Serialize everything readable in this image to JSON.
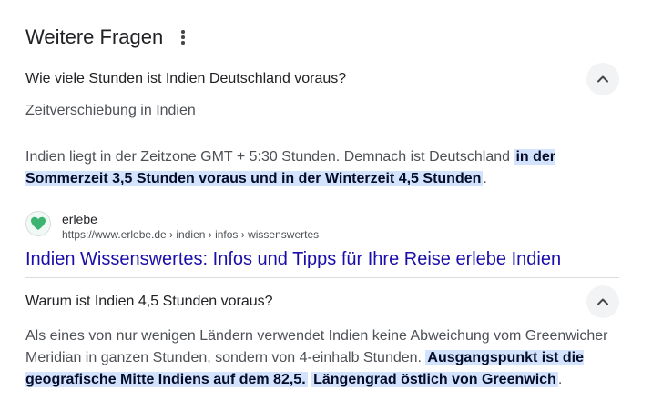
{
  "section": {
    "title": "Weitere Fragen",
    "more_icon": "more-vert-icon"
  },
  "questions": [
    {
      "question": "Wie viele Stunden ist Indien Deutschland voraus?",
      "expanded": true,
      "answer_heading": "Zeitverschiebung in Indien",
      "answer_plain": "Indien liegt in der Zeitzone GMT + 5:30 Stunden. Demnach ist Deutschland ",
      "answer_highlight": "in der Sommerzeit 3,5 Stunden voraus und in der Winterzeit 4,5 Stunden",
      "answer_end": ".",
      "source": {
        "name": "erlebe",
        "url": "https://www.erlebe.de › indien › infos › wissenswertes",
        "favicon": "heart-icon",
        "favicon_color": "#3cb371"
      },
      "result_title": "Indien Wissenswertes: Infos und Tipps für Ihre Reise erlebe Indien"
    },
    {
      "question": "Warum ist Indien 4,5 Stunden voraus?",
      "expanded": true,
      "answer_plain": "Als eines von nur wenigen Ländern verwendet Indien keine Abweichung vom Greenwicher Meridian in ganzen Stunden, sondern von 4-einhalb Stunden. ",
      "answer_highlight_1": "Ausgangspunkt ist die geografische Mitte Indiens auf dem 82,5.",
      "answer_highlight_2": "Längengrad östlich von Greenwich",
      "answer_end": "."
    }
  ],
  "colors": {
    "link": "#1a0dab",
    "highlight_bg": "#d3e3fd",
    "text": "#202124",
    "muted": "#4d5156"
  }
}
